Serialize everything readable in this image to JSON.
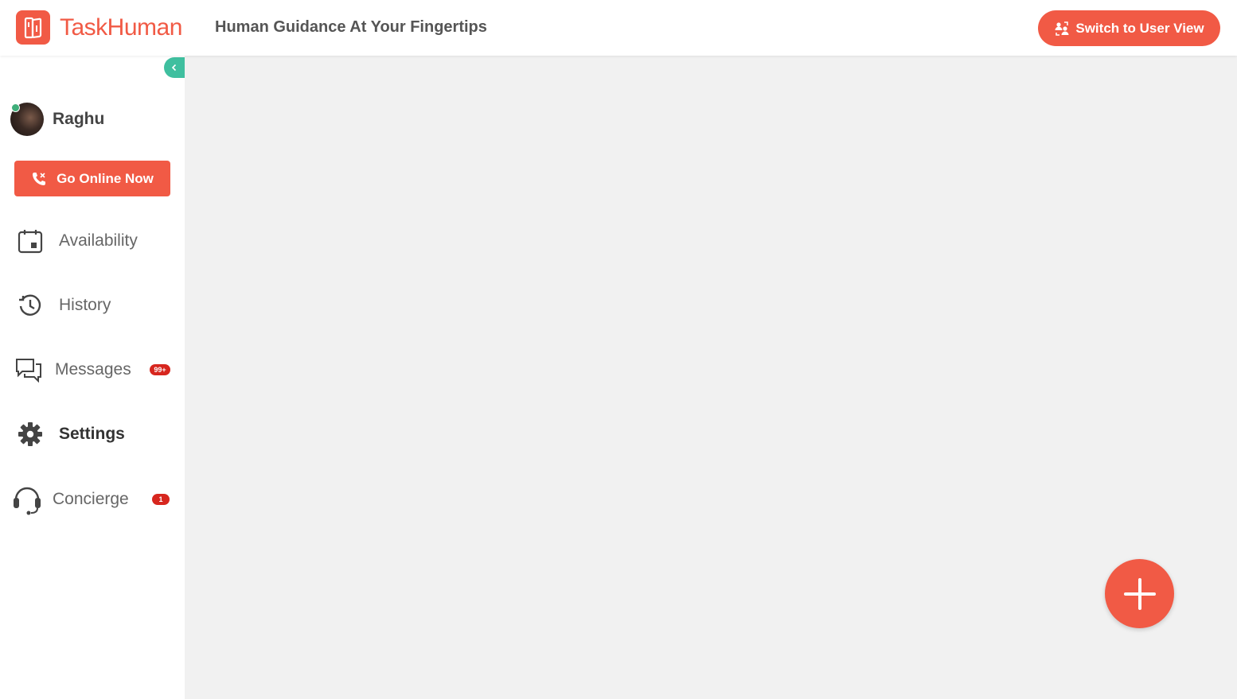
{
  "header": {
    "brand": "TaskHuman",
    "tagline": "Human Guidance At Your Fingertips",
    "switch_button": "Switch to User View"
  },
  "sidebar": {
    "collapse_icon": "chevron-left-icon",
    "profile": {
      "name": "Raghu",
      "status": "online"
    },
    "go_online_button": "Go Online Now",
    "items": [
      {
        "label": "Availability",
        "icon": "calendar-icon",
        "badge": ""
      },
      {
        "label": "History",
        "icon": "history-icon",
        "badge": ""
      },
      {
        "label": "Messages",
        "icon": "chat-icon",
        "badge": "99+"
      },
      {
        "label": "Settings",
        "icon": "gear-icon",
        "badge": "",
        "active": true
      },
      {
        "label": "Concierge",
        "icon": "headset-icon",
        "badge": "1"
      }
    ]
  },
  "fab": {
    "icon": "plus-icon"
  },
  "colors": {
    "brand": "#f15a45",
    "accent_teal": "#3fbf9f",
    "badge_red": "#d7261e",
    "content_bg": "#f1f1f1"
  }
}
